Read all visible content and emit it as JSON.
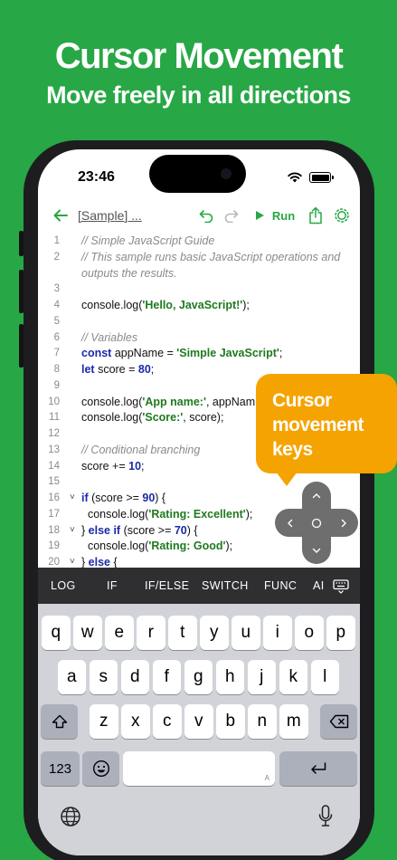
{
  "promo": {
    "headline": "Cursor Movement",
    "subheadline": "Move freely in all directions"
  },
  "status_bar": {
    "time": "23:46"
  },
  "toolbar": {
    "file_title": "[Sample] ...",
    "run_label": "Run",
    "icons": [
      "back-arrow-icon",
      "undo-icon",
      "redo-icon",
      "play-icon",
      "share-icon",
      "settings-icon"
    ]
  },
  "editor": {
    "lines": [
      {
        "n": "1",
        "fold": "",
        "parts": [
          {
            "t": "// Simple JavaScript Guide",
            "c": "cm"
          }
        ]
      },
      {
        "n": "2",
        "fold": "",
        "parts": [
          {
            "t": "// This sample runs basic JavaScript operations and",
            "c": "cm"
          }
        ]
      },
      {
        "n": "",
        "fold": "",
        "parts": [
          {
            "t": "outputs the results.",
            "c": "cm"
          }
        ]
      },
      {
        "n": "3",
        "fold": "",
        "parts": []
      },
      {
        "n": "4",
        "fold": "",
        "parts": [
          {
            "t": "console.log(",
            "c": ""
          },
          {
            "t": "'Hello, JavaScript!'",
            "c": "str"
          },
          {
            "t": ");",
            "c": ""
          }
        ]
      },
      {
        "n": "5",
        "fold": "",
        "parts": []
      },
      {
        "n": "6",
        "fold": "",
        "parts": [
          {
            "t": "// Variables",
            "c": "cm"
          }
        ]
      },
      {
        "n": "7",
        "fold": "",
        "parts": [
          {
            "t": "const",
            "c": "kw"
          },
          {
            "t": " appName = ",
            "c": ""
          },
          {
            "t": "'Simple JavaScript'",
            "c": "str"
          },
          {
            "t": ";",
            "c": ""
          }
        ]
      },
      {
        "n": "8",
        "fold": "",
        "parts": [
          {
            "t": "let",
            "c": "kw"
          },
          {
            "t": " score = ",
            "c": ""
          },
          {
            "t": "80",
            "c": "num"
          },
          {
            "t": ";",
            "c": ""
          }
        ]
      },
      {
        "n": "9",
        "fold": "",
        "parts": []
      },
      {
        "n": "10",
        "fold": "",
        "parts": [
          {
            "t": "console.log(",
            "c": ""
          },
          {
            "t": "'App name:'",
            "c": "str"
          },
          {
            "t": ", appNam",
            "c": ""
          }
        ]
      },
      {
        "n": "11",
        "fold": "",
        "parts": [
          {
            "t": "console.log(",
            "c": ""
          },
          {
            "t": "'Score:'",
            "c": "str"
          },
          {
            "t": ", score);",
            "c": ""
          }
        ]
      },
      {
        "n": "12",
        "fold": "",
        "parts": []
      },
      {
        "n": "13",
        "fold": "",
        "parts": [
          {
            "t": "// Conditional branching",
            "c": "cm"
          }
        ]
      },
      {
        "n": "14",
        "fold": "",
        "parts": [
          {
            "t": "score += ",
            "c": ""
          },
          {
            "t": "10",
            "c": "num"
          },
          {
            "t": ";",
            "c": ""
          }
        ]
      },
      {
        "n": "15",
        "fold": "",
        "parts": []
      },
      {
        "n": "16",
        "fold": "˅",
        "parts": [
          {
            "t": "if",
            "c": "kw"
          },
          {
            "t": " (score >= ",
            "c": ""
          },
          {
            "t": "90",
            "c": "num"
          },
          {
            "t": ") {",
            "c": ""
          }
        ]
      },
      {
        "n": "17",
        "fold": "",
        "parts": [
          {
            "t": "  console.log(",
            "c": ""
          },
          {
            "t": "'Rating: Excellent'",
            "c": "str"
          },
          {
            "t": ");",
            "c": ""
          }
        ]
      },
      {
        "n": "18",
        "fold": "˅",
        "parts": [
          {
            "t": "} ",
            "c": ""
          },
          {
            "t": "else if",
            "c": "kw"
          },
          {
            "t": " (score >= ",
            "c": ""
          },
          {
            "t": "70",
            "c": "num"
          },
          {
            "t": ") {",
            "c": ""
          }
        ]
      },
      {
        "n": "19",
        "fold": "",
        "parts": [
          {
            "t": "  console.log(",
            "c": ""
          },
          {
            "t": "'Rating: Good'",
            "c": "str"
          },
          {
            "t": ");",
            "c": ""
          }
        ]
      },
      {
        "n": "20",
        "fold": "˅",
        "parts": [
          {
            "t": "} ",
            "c": ""
          },
          {
            "t": "else",
            "c": "kw"
          },
          {
            "t": " {",
            "c": ""
          }
        ]
      }
    ]
  },
  "snippet_bar": {
    "items": [
      "LOG",
      "IF",
      "IF/ELSE",
      "SWITCH",
      "FUNC",
      "AI"
    ]
  },
  "keyboard": {
    "row1": [
      "q",
      "w",
      "e",
      "r",
      "t",
      "y",
      "u",
      "i",
      "o",
      "p"
    ],
    "row2": [
      "a",
      "s",
      "d",
      "f",
      "g",
      "h",
      "j",
      "k",
      "l"
    ],
    "row3": [
      "z",
      "x",
      "c",
      "v",
      "b",
      "n",
      "m"
    ],
    "numbers_key": "123",
    "space_hint": "A"
  },
  "callout": {
    "text": "Cursor movement keys"
  },
  "cursor_pad": {
    "icons": [
      "cursor-up-icon",
      "cursor-down-icon",
      "cursor-left-icon",
      "cursor-right-icon",
      "cursor-center-icon"
    ]
  },
  "colors": {
    "background": "#27a745",
    "accent": "#27a745",
    "callout": "#f5a300",
    "snippet_bar": "#2f2f31",
    "keyboard": "#d1d3d9"
  }
}
